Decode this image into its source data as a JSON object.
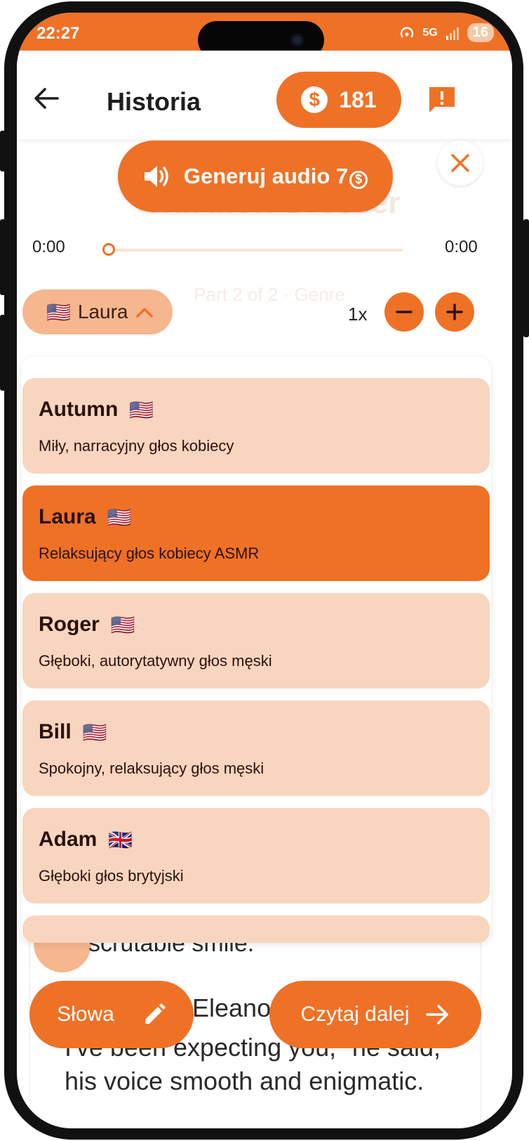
{
  "status": {
    "time": "22:27",
    "battery": "16",
    "network": "5G"
  },
  "header": {
    "title": "Historia",
    "coins": "181"
  },
  "background": {
    "title": "\"W... ...ow Dresser",
    "meta": "Part 2 of 2 · Genre"
  },
  "generate_audio": {
    "label": "Generuj audio 7"
  },
  "player": {
    "current": "0:00",
    "duration": "0:00",
    "progress": 0
  },
  "voice_selector": {
    "selected": "Laura",
    "speed": "1x"
  },
  "voices": [
    {
      "name": "Autumn",
      "flag": "🇺🇸",
      "desc": "Miły, narracyjny głos kobiecy",
      "selected": false
    },
    {
      "name": "Laura",
      "flag": "🇺🇸",
      "desc": "Relaksujący głos kobiecy ASMR",
      "selected": true
    },
    {
      "name": "Roger",
      "flag": "🇺🇸",
      "desc": "Głęboki, autorytatywny głos męski",
      "selected": false
    },
    {
      "name": "Bill",
      "flag": "🇺🇸",
      "desc": "Spokojny, relaksujący głos męski",
      "selected": false
    },
    {
      "name": "Adam",
      "flag": "🇬🇧",
      "desc": "Głęboki głos brytyjski",
      "selected": false
    }
  ],
  "story": {
    "line1": "scrutable smile.",
    "line2": "Eleanor",
    "line3": "I've been expecting you,\" he said,",
    "line4": "his voice smooth and enigmatic."
  },
  "bottom_buttons": {
    "words": "Słowa",
    "continue": "Czytaj dalej"
  },
  "colors": {
    "accent": "#ef7126",
    "accent_light": "#f8d5bf",
    "pill": "#f6b68e"
  }
}
